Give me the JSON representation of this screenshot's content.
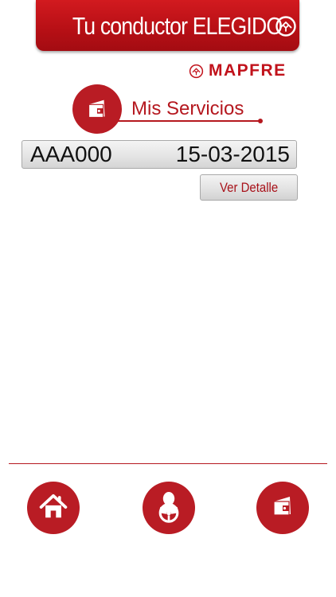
{
  "header": {
    "title": "Tu conductor ELEGIDO",
    "logo_icon": "mapfre-symbol-icon",
    "background": "#b91c24"
  },
  "brand": {
    "name": "MAPFRE",
    "logo_icon": "mapfre-symbol-icon",
    "color": "#c1121b"
  },
  "section": {
    "title": "Mis Servicios",
    "icon": "wallet-icon"
  },
  "services": [
    {
      "plate": "AAA000",
      "date": "15-03-2015"
    }
  ],
  "actions": {
    "detail_label": "Ver Detalle"
  },
  "bottom_nav": [
    {
      "name": "home",
      "icon": "home-icon"
    },
    {
      "name": "driver",
      "icon": "driver-steering-wheel-icon"
    },
    {
      "name": "services",
      "icon": "wallet-icon"
    }
  ]
}
